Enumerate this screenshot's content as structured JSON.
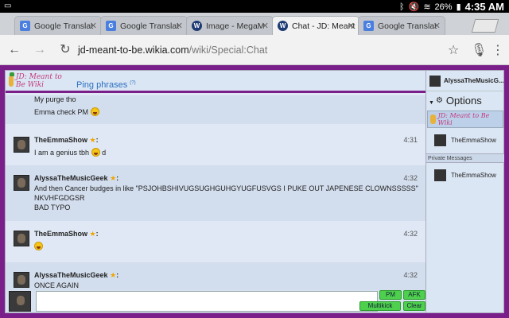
{
  "status_bar": {
    "battery": "26%",
    "time": "4:35 AM"
  },
  "tabs": [
    {
      "title": "Google Translat",
      "favicon": "google-translate-icon",
      "active": false
    },
    {
      "title": "Google Translat",
      "favicon": "google-translate-icon",
      "active": false
    },
    {
      "title": "Image - MegaM",
      "favicon": "wikia-icon",
      "active": false
    },
    {
      "title": "Chat - JD: Meant",
      "favicon": "wikia-icon",
      "active": true
    },
    {
      "title": "Google Translat",
      "favicon": "google-translate-icon",
      "active": false
    }
  ],
  "toolbar": {
    "url_host": "jd-meant-to-be.wikia.com",
    "url_path": "/wiki/Special:Chat"
  },
  "chat": {
    "logo_text": "JD: Meant to Be Wiki",
    "ping_label": "Ping phrases",
    "ping_help": "(?)",
    "messages": [
      {
        "user": "",
        "time": "",
        "lines": [
          "My purge tho",
          "Emma check PM"
        ]
      },
      {
        "user": "TheEmmaShow",
        "time": "4:31",
        "lines": [
          "I am a genius tbh",
          "d"
        ]
      },
      {
        "user": "AlyssaTheMusicGeek",
        "time": "4:32",
        "lines": [
          "And then Cancer budges in like \"PSJOHBSHIVUGSUGHGUHGYUGFUSVGS I PUKE OUT JAPENESE CLOWNSSSSS\"",
          "NKVHFGDGSR",
          "BAD TYPO"
        ]
      },
      {
        "user": "TheEmmaShow",
        "time": "4:32",
        "lines": []
      },
      {
        "user": "AlyssaTheMusicGeek",
        "time": "4:32",
        "lines": [
          "ONCE AGAIN"
        ]
      }
    ],
    "buttons": {
      "pm": "PM",
      "afk": "AFK",
      "multikick": "Multikick",
      "clear": "Clear"
    }
  },
  "sidebar": {
    "current_user": "AlyssaTheMusicG...",
    "options_label": "Options",
    "wiki_label": "JD: Meant to Be Wiki",
    "users": [
      "TheEmmaShow"
    ],
    "private_label": "Private Messages",
    "private_users": [
      "TheEmmaShow"
    ]
  }
}
